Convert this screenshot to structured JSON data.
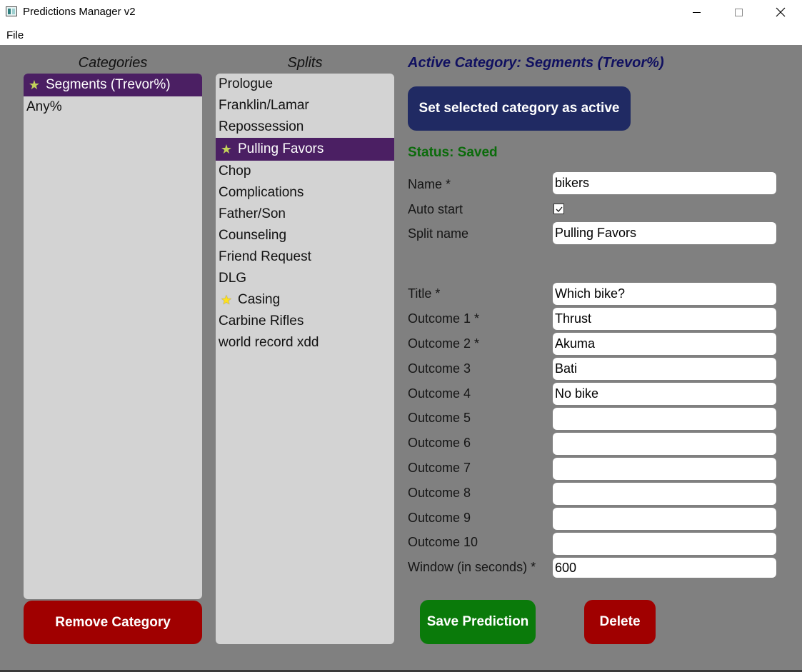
{
  "window": {
    "title": "Predictions Manager v2",
    "minimize_icon": "minimize-icon",
    "maximize_icon": "maximize-icon",
    "close_icon": "close-icon"
  },
  "menu": {
    "items": [
      "File"
    ]
  },
  "categories": {
    "header": "Categories",
    "items": [
      {
        "label": "Segments (Trevor%)",
        "starred": true,
        "selected": true
      },
      {
        "label": "Any%",
        "starred": false,
        "selected": false
      }
    ],
    "remove_button": "Remove Category"
  },
  "splits": {
    "header": "Splits",
    "items": [
      {
        "label": "Prologue",
        "star": "none",
        "selected": false
      },
      {
        "label": "Franklin/Lamar",
        "star": "none",
        "selected": false
      },
      {
        "label": "Repossession",
        "star": "none",
        "selected": false
      },
      {
        "label": "Pulling Favors",
        "star": "filled",
        "selected": true
      },
      {
        "label": "Chop",
        "star": "none",
        "selected": false
      },
      {
        "label": "Complications",
        "star": "none",
        "selected": false
      },
      {
        "label": "Father/Son",
        "star": "none",
        "selected": false
      },
      {
        "label": "Counseling",
        "star": "none",
        "selected": false
      },
      {
        "label": "Friend Request",
        "star": "none",
        "selected": false
      },
      {
        "label": "DLG",
        "star": "none",
        "selected": false
      },
      {
        "label": "Casing",
        "star": "outline",
        "selected": false
      },
      {
        "label": "Carbine Rifles",
        "star": "none",
        "selected": false
      },
      {
        "label": "world record xdd",
        "star": "none",
        "selected": false
      }
    ]
  },
  "editor": {
    "active_category": "Active Category: Segments (Trevor%)",
    "set_active_button": "Set selected category as active",
    "status": "Status: Saved",
    "name_label": "Name *",
    "name_value": "bikers",
    "auto_start_label": "Auto start",
    "auto_start_checked": true,
    "split_name_label": "Split name",
    "split_name_value": "Pulling Favors",
    "title_label": "Title *",
    "title_value": "Which bike?",
    "outcomes": [
      {
        "label": "Outcome 1 *",
        "value": "Thrust"
      },
      {
        "label": "Outcome 2 *",
        "value": "Akuma"
      },
      {
        "label": "Outcome 3",
        "value": "Bati"
      },
      {
        "label": "Outcome 4",
        "value": "No bike"
      },
      {
        "label": "Outcome 5",
        "value": ""
      },
      {
        "label": "Outcome 6",
        "value": ""
      },
      {
        "label": "Outcome 7",
        "value": ""
      },
      {
        "label": "Outcome 8",
        "value": ""
      },
      {
        "label": "Outcome 9",
        "value": ""
      },
      {
        "label": "Outcome 10",
        "value": ""
      }
    ],
    "window_label": "Window (in seconds) *",
    "window_value": "600",
    "save_button": "Save Prediction",
    "delete_button": "Delete"
  },
  "colors": {
    "background": "#808080",
    "list_bg": "#d3d3d3",
    "selected_item": "#4b1f63",
    "danger": "#a00000",
    "success": "#0a7a0a",
    "primary": "#202a63",
    "status_text": "#0b6b0b",
    "active_category_text": "#101060"
  }
}
